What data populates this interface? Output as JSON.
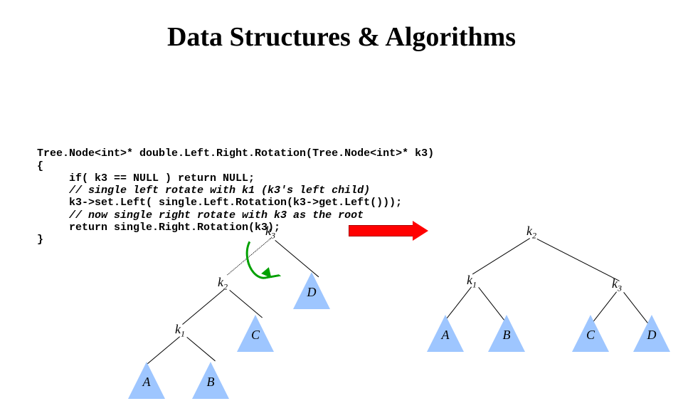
{
  "title": "Data Structures & Algorithms",
  "code": {
    "l1": "Tree.Node<int>* double.Left.Right.Rotation(Tree.Node<int>* k3)",
    "l2": "{",
    "l3": "     if( k3 == NULL ) return NULL;",
    "l4": "     // single left rotate with k1 (k3's left child)",
    "l5": "     k3->set.Left( single.Left.Rotation(k3->get.Left()));",
    "l6": "     // now single right rotate with k3 as the root",
    "l7": "     return single.Right.Rotation(k3);",
    "l8": "}"
  },
  "leftTree": {
    "root": {
      "k": "k",
      "sub": "3"
    },
    "n2": {
      "k": "k",
      "sub": "2"
    },
    "n1": {
      "k": "k",
      "sub": "1"
    },
    "triA": "A",
    "triB": "B",
    "triC": "C",
    "triD": "D"
  },
  "rightTree": {
    "root": {
      "k": "k",
      "sub": "2"
    },
    "n1": {
      "k": "k",
      "sub": "1"
    },
    "n3": {
      "k": "k",
      "sub": "3"
    },
    "triA": "A",
    "triB": "B",
    "triC": "C",
    "triD": "D"
  },
  "colors": {
    "triangleFill": "#9ec6ff",
    "arrow": "#ff0000",
    "arc": "#00a000"
  }
}
